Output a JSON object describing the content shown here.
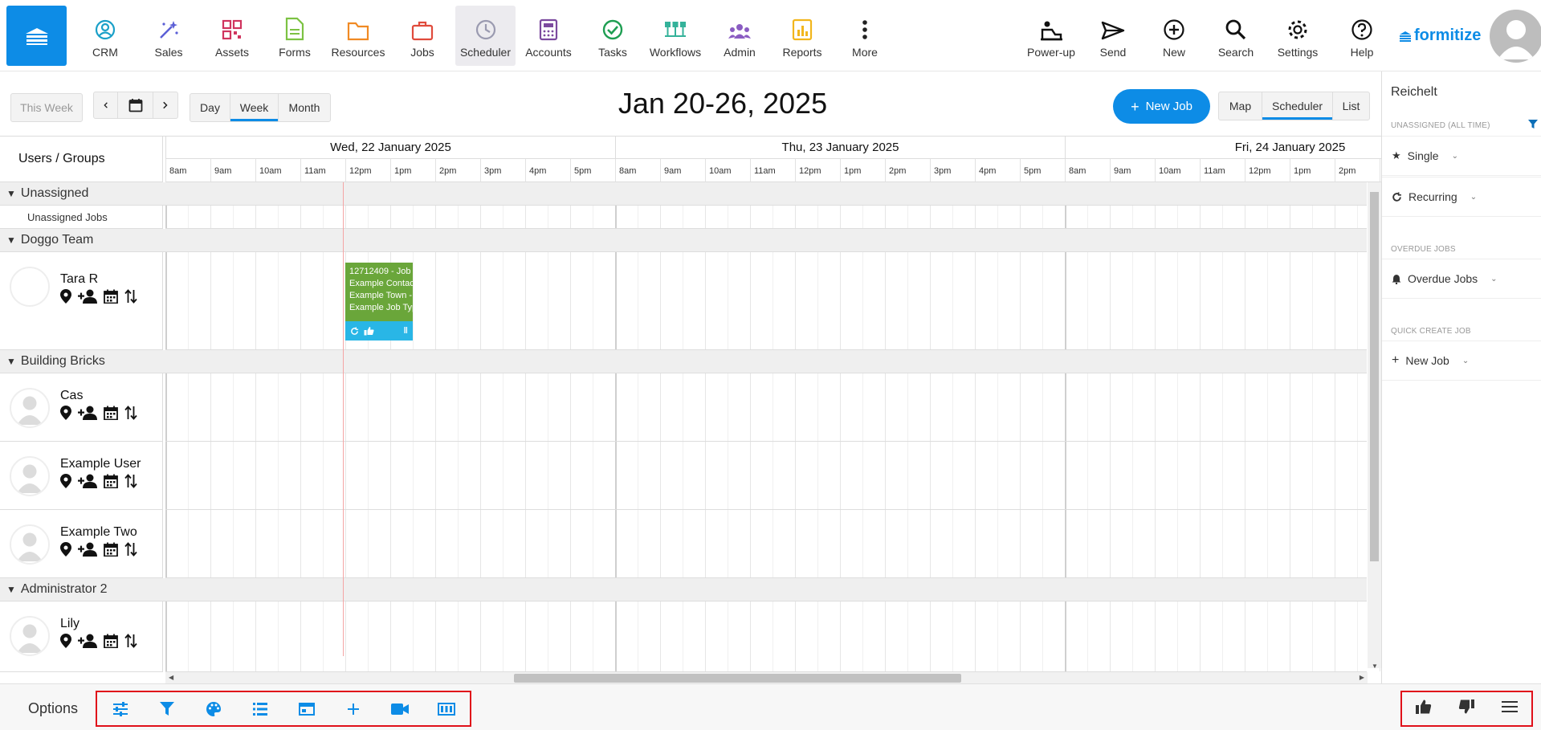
{
  "nav": {
    "items": [
      {
        "label": "CRM",
        "icon": "crm-icon",
        "color": "#1aa0c8"
      },
      {
        "label": "Sales",
        "icon": "sales-icon",
        "color": "#5b5fd6"
      },
      {
        "label": "Assets",
        "icon": "assets-icon",
        "color": "#d0345e"
      },
      {
        "label": "Forms",
        "icon": "forms-icon",
        "color": "#7cc243"
      },
      {
        "label": "Resources",
        "icon": "resources-icon",
        "color": "#f08a24"
      },
      {
        "label": "Jobs",
        "icon": "jobs-icon",
        "color": "#e04b3c"
      },
      {
        "label": "Scheduler",
        "icon": "scheduler-icon",
        "color": "#9a9ab0"
      },
      {
        "label": "Accounts",
        "icon": "accounts-icon",
        "color": "#7c4a9e"
      },
      {
        "label": "Tasks",
        "icon": "tasks-icon",
        "color": "#1e9e52"
      },
      {
        "label": "Workflows",
        "icon": "workflows-icon",
        "color": "#34b29a"
      },
      {
        "label": "Admin",
        "icon": "admin-icon",
        "color": "#8a5cc2"
      },
      {
        "label": "Reports",
        "icon": "reports-icon",
        "color": "#f2b61d"
      },
      {
        "label": "More",
        "icon": "more-icon",
        "color": "#222222"
      }
    ],
    "right_items": [
      {
        "label": "Power-up",
        "icon": "power-up-icon"
      },
      {
        "label": "Send",
        "icon": "send-icon"
      },
      {
        "label": "New",
        "icon": "new-icon"
      },
      {
        "label": "Search",
        "icon": "search-icon"
      },
      {
        "label": "Settings",
        "icon": "settings-icon"
      },
      {
        "label": "Help",
        "icon": "help-icon"
      }
    ],
    "logo_text": "formitize",
    "accent": "#0d8ce6"
  },
  "toolbar": {
    "this_week": "This Week",
    "views": [
      "Day",
      "Week",
      "Month"
    ],
    "active_view": "Week",
    "title": "Jan 20-26, 2025",
    "new_job": "New Job",
    "modes": [
      "Map",
      "Scheduler",
      "List"
    ],
    "active_mode": "Scheduler"
  },
  "grid": {
    "users_groups_label": "Users / Groups",
    "days": [
      "Wed, 22 January 2025",
      "Thu, 23 January 2025",
      "Fri, 24 January 2025"
    ],
    "hours": [
      "8am",
      "9am",
      "10am",
      "11am",
      "12pm",
      "1pm",
      "2pm",
      "3pm",
      "4pm",
      "5pm"
    ],
    "groups": [
      {
        "name": "Unassigned",
        "rows": [
          {
            "label": "Unassigned Jobs"
          }
        ]
      },
      {
        "name": "Doggo Team",
        "rows": [
          {
            "name": "Tara R"
          }
        ]
      },
      {
        "name": "Building Bricks",
        "rows": [
          {
            "name": "Cas"
          },
          {
            "name": "Example User"
          },
          {
            "name": "Example Two"
          }
        ]
      },
      {
        "name": "Administrator 2",
        "rows": [
          {
            "name": "Lily"
          }
        ]
      }
    ],
    "job": {
      "lines": [
        "12712409 - Job",
        "Example Contact",
        "Example Town -",
        "Example Job Type"
      ],
      "color": "#6aa63a",
      "bar_color": "#29b6e6"
    }
  },
  "panel": {
    "title": "Reichelt",
    "unassigned_label": "UNASSIGNED (ALL TIME)",
    "single": "Single",
    "recurring": "Recurring",
    "overdue_label": "OVERDUE JOBS",
    "overdue_item": "Overdue Jobs",
    "quick_label": "QUICK CREATE JOB",
    "quick_item": "New Job"
  },
  "footer": {
    "options_label": "Options",
    "option_icons": [
      "sliders-icon",
      "filter-icon",
      "palette-icon",
      "list-icon",
      "window-icon",
      "plus-icon",
      "video-icon",
      "id-card-icon"
    ],
    "feedback_icons": [
      "thumbs-up-icon",
      "thumbs-down-icon",
      "menu-icon"
    ]
  }
}
